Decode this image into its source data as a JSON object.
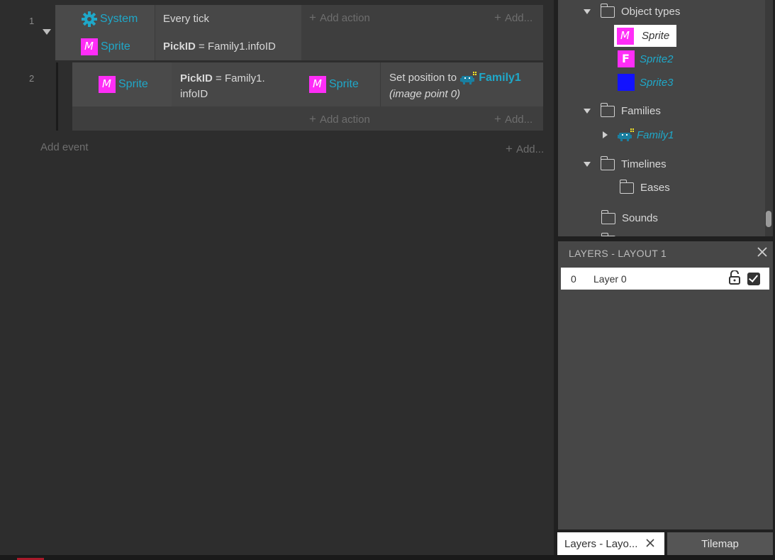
{
  "events": [
    {
      "number": "1",
      "conditions": [
        {
          "object": "System",
          "icon": "gear-icon",
          "text": "Every tick"
        },
        {
          "object": "Sprite",
          "icon": "sprite-icon",
          "bold": "PickID",
          "text": " = Family1.infoID"
        }
      ],
      "add_action": "Add action",
      "add_more": "Add..."
    },
    {
      "number": "2",
      "conditions": [
        {
          "object": "Sprite",
          "icon": "sprite-icon",
          "bold": "PickID",
          "text_line1": " = Family1.",
          "text_line2": "infoID"
        }
      ],
      "actions": [
        {
          "object": "Sprite",
          "icon": "sprite-icon",
          "text": "Set position to ",
          "target": "Family1",
          "text2": "(image point 0)"
        }
      ],
      "add_action": "Add action",
      "add_more": "Add..."
    }
  ],
  "add_event": "Add event",
  "add_event_more": "Add...",
  "project": {
    "object_types_label": "Object types",
    "objects": [
      {
        "name": "Sprite",
        "icon": "sprite-m-icon",
        "selected": true
      },
      {
        "name": "Sprite2",
        "icon": "sprite-f-icon",
        "selected": false
      },
      {
        "name": "Sprite3",
        "icon": "sprite-blue-icon",
        "selected": false
      }
    ],
    "families_label": "Families",
    "family": "Family1",
    "timelines_label": "Timelines",
    "eases_label": "Eases",
    "sounds_label": "Sounds"
  },
  "layers": {
    "title": "LAYERS - LAYOUT 1",
    "rows": [
      {
        "index": "0",
        "name": "Layer 0"
      }
    ]
  },
  "tabs": [
    {
      "label": "Layers - Layo...",
      "active": true
    },
    {
      "label": "Tilemap",
      "active": false
    }
  ],
  "colors": {
    "accent": "#1fa8c9",
    "sprite": "#ff2df7",
    "sprite3": "#1212ff",
    "panel": "#454545"
  }
}
